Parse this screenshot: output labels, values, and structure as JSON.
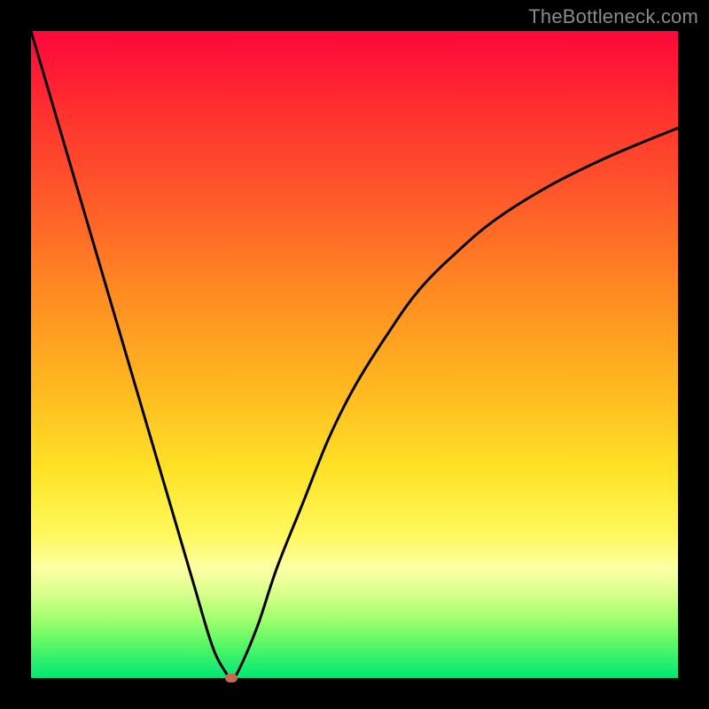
{
  "watermark": "TheBottleneck.com",
  "colors": {
    "frame": "#000000",
    "gradient_top": "#ff073a",
    "gradient_bottom": "#00e776",
    "curve": "#000000",
    "marker": "#c96a4f"
  },
  "chart_data": {
    "type": "line",
    "title": "",
    "xlabel": "",
    "ylabel": "",
    "xlim": [
      0,
      100
    ],
    "ylim": [
      0,
      100
    ],
    "grid": false,
    "series": [
      {
        "name": "bottleneck-curve",
        "x": [
          0,
          5,
          10,
          15,
          20,
          25,
          28,
          30,
          31,
          32,
          35,
          38,
          42,
          46,
          50,
          55,
          60,
          66,
          72,
          80,
          88,
          95,
          100
        ],
        "values": [
          100,
          83,
          66,
          49,
          32,
          15,
          5,
          1,
          0,
          1,
          8,
          17,
          27,
          37,
          45,
          53,
          60,
          66,
          71,
          76,
          80,
          83,
          85
        ]
      }
    ],
    "annotations": [
      {
        "name": "minimum-marker",
        "x": 31,
        "y": 0
      }
    ]
  }
}
